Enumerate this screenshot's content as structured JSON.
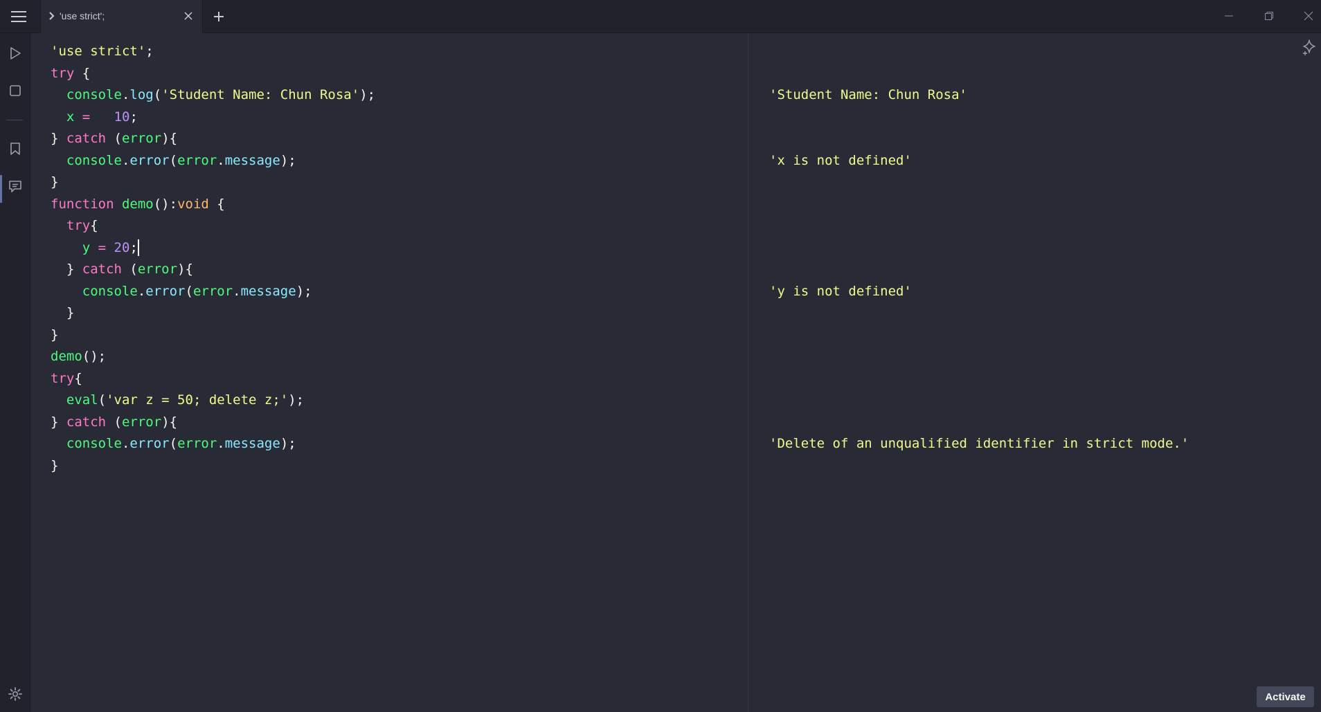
{
  "tab": {
    "title": "'use strict';"
  },
  "activate_label": "Activate",
  "colors": {
    "background": "#282a36",
    "string": "#f1fa8c",
    "keyword": "#ff79c6",
    "function": "#50fa7b",
    "property": "#8be9fd",
    "number": "#bd93f9",
    "type": "#ffb86c"
  },
  "icons": {
    "menu": "hamburger-menu-icon",
    "tab_chevron": "chevron-right-icon",
    "tab_close": "close-icon",
    "new_tab": "plus-icon",
    "run": "play-icon",
    "stop": "stop-icon",
    "bookmark": "bookmark-icon",
    "comments": "comment-icon",
    "settings": "gear-icon",
    "ai": "sparkle-icon"
  },
  "code": [
    [
      {
        "t": "'use strict'",
        "c": "str"
      },
      {
        "t": ";",
        "c": "pun"
      }
    ],
    [
      {
        "t": "try",
        "c": "kw"
      },
      {
        "t": " {",
        "c": "pun"
      }
    ],
    [
      {
        "t": "  ",
        "c": "pun"
      },
      {
        "t": "console",
        "c": "fn"
      },
      {
        "t": ".",
        "c": "pun"
      },
      {
        "t": "log",
        "c": "prop"
      },
      {
        "t": "(",
        "c": "pun"
      },
      {
        "t": "'Student Name: Chun Rosa'",
        "c": "str"
      },
      {
        "t": ");",
        "c": "pun"
      }
    ],
    [
      {
        "t": "  ",
        "c": "pun"
      },
      {
        "t": "x",
        "c": "var"
      },
      {
        "t": " = ",
        "c": "op"
      },
      {
        "t": "  ",
        "c": "pun"
      },
      {
        "t": "10",
        "c": "num"
      },
      {
        "t": ";",
        "c": "pun"
      }
    ],
    [
      {
        "t": "} ",
        "c": "pun"
      },
      {
        "t": "catch",
        "c": "kw"
      },
      {
        "t": " (",
        "c": "pun"
      },
      {
        "t": "error",
        "c": "fn"
      },
      {
        "t": "){",
        "c": "pun"
      }
    ],
    [
      {
        "t": "  ",
        "c": "pun"
      },
      {
        "t": "console",
        "c": "fn"
      },
      {
        "t": ".",
        "c": "pun"
      },
      {
        "t": "error",
        "c": "prop"
      },
      {
        "t": "(",
        "c": "pun"
      },
      {
        "t": "error",
        "c": "fn"
      },
      {
        "t": ".",
        "c": "pun"
      },
      {
        "t": "message",
        "c": "prop"
      },
      {
        "t": ");",
        "c": "pun"
      }
    ],
    [
      {
        "t": "}",
        "c": "pun"
      }
    ],
    [
      {
        "t": "function",
        "c": "kw"
      },
      {
        "t": " ",
        "c": "pun"
      },
      {
        "t": "demo",
        "c": "fn"
      },
      {
        "t": "():",
        "c": "pun"
      },
      {
        "t": "void",
        "c": "type"
      },
      {
        "t": " {",
        "c": "pun"
      }
    ],
    [
      {
        "t": "  ",
        "c": "pun"
      },
      {
        "t": "try",
        "c": "kw"
      },
      {
        "t": "{",
        "c": "pun"
      }
    ],
    [
      {
        "t": "    ",
        "c": "pun"
      },
      {
        "t": "y",
        "c": "var"
      },
      {
        "t": " = ",
        "c": "op"
      },
      {
        "t": "20",
        "c": "num"
      },
      {
        "t": ";",
        "c": "pun"
      }
    ],
    [
      {
        "t": "  } ",
        "c": "pun"
      },
      {
        "t": "catch",
        "c": "kw"
      },
      {
        "t": " (",
        "c": "pun"
      },
      {
        "t": "error",
        "c": "fn"
      },
      {
        "t": "){",
        "c": "pun"
      }
    ],
    [
      {
        "t": "    ",
        "c": "pun"
      },
      {
        "t": "console",
        "c": "fn"
      },
      {
        "t": ".",
        "c": "pun"
      },
      {
        "t": "error",
        "c": "prop"
      },
      {
        "t": "(",
        "c": "pun"
      },
      {
        "t": "error",
        "c": "fn"
      },
      {
        "t": ".",
        "c": "pun"
      },
      {
        "t": "message",
        "c": "prop"
      },
      {
        "t": ");",
        "c": "pun"
      }
    ],
    [
      {
        "t": "  }",
        "c": "pun"
      }
    ],
    [
      {
        "t": "}",
        "c": "pun"
      }
    ],
    [
      {
        "t": "demo",
        "c": "fn"
      },
      {
        "t": "();",
        "c": "pun"
      }
    ],
    [
      {
        "t": "try",
        "c": "kw"
      },
      {
        "t": "{",
        "c": "pun"
      }
    ],
    [
      {
        "t": "  ",
        "c": "pun"
      },
      {
        "t": "eval",
        "c": "fn"
      },
      {
        "t": "(",
        "c": "pun"
      },
      {
        "t": "'var z = 50; delete z;'",
        "c": "str"
      },
      {
        "t": ");",
        "c": "pun"
      }
    ],
    [
      {
        "t": "} ",
        "c": "pun"
      },
      {
        "t": "catch",
        "c": "kw"
      },
      {
        "t": " (",
        "c": "pun"
      },
      {
        "t": "error",
        "c": "fn"
      },
      {
        "t": "){",
        "c": "pun"
      }
    ],
    [
      {
        "t": "  ",
        "c": "pun"
      },
      {
        "t": "console",
        "c": "fn"
      },
      {
        "t": ".",
        "c": "pun"
      },
      {
        "t": "error",
        "c": "prop"
      },
      {
        "t": "(",
        "c": "pun"
      },
      {
        "t": "error",
        "c": "fn"
      },
      {
        "t": ".",
        "c": "pun"
      },
      {
        "t": "message",
        "c": "prop"
      },
      {
        "t": ");",
        "c": "pun"
      }
    ],
    [
      {
        "t": "}",
        "c": "pun"
      }
    ]
  ],
  "caret_line": 9,
  "output": [
    {
      "line": 2,
      "text": "'Student Name: Chun Rosa'"
    },
    {
      "line": 5,
      "text": "'x is not defined'"
    },
    {
      "line": 11,
      "text": "'y is not defined'"
    },
    {
      "line": 18,
      "text": "'Delete of an unqualified identifier in strict mode.'"
    }
  ]
}
